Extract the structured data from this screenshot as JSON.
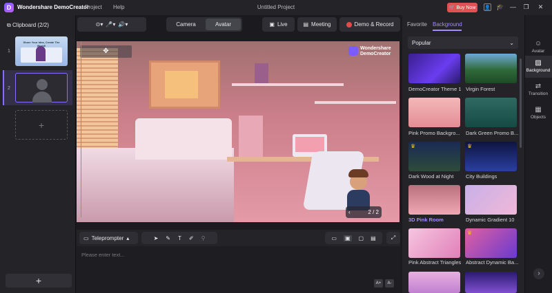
{
  "app": {
    "name": "Wondershare DemoCreator",
    "logo_letter": "D",
    "menu": [
      "Project",
      "Help"
    ],
    "doc_title": "Untitled Project",
    "buy_label": "Buy Now"
  },
  "left": {
    "clipboard_label": "Clipboard (2/2)",
    "clip_numbers": [
      "1",
      "2"
    ],
    "clip1_caption": "Share Your Idea, Create The World!",
    "add_symbol": "+"
  },
  "toolbar": {
    "camera": "Camera",
    "avatar": "Avatar",
    "live": "Live",
    "meeting": "Meeting",
    "demo_record": "Demo & Record"
  },
  "canvas": {
    "watermark_line1": "Wondershare",
    "watermark_line2": "DemoCreator",
    "pager": "2 / 2"
  },
  "teleprompter": {
    "label": "Teleprompter",
    "placeholder": "Please enter text...",
    "font_up": "A+",
    "font_down": "A-"
  },
  "right": {
    "tab_favorite": "Favorite",
    "tab_background": "Background",
    "dropdown_value": "Popular",
    "backgrounds": [
      {
        "label": "DemoCreator Theme 1",
        "selected": false
      },
      {
        "label": "Virgin Forest",
        "selected": false
      },
      {
        "label": "Pink Promo Backgro...",
        "selected": false
      },
      {
        "label": "Dark Green Promo B...",
        "selected": false
      },
      {
        "label": "Dark Wood at Night",
        "selected": false
      },
      {
        "label": "City Buildings",
        "selected": false
      },
      {
        "label": "3D Pink Room",
        "selected": true
      },
      {
        "label": "Dynamic Gradient 10",
        "selected": false
      },
      {
        "label": "Pink Abstract Triangles",
        "selected": false
      },
      {
        "label": "Abstract Dynamic Ba...",
        "selected": false
      }
    ]
  },
  "rail": {
    "avatar": "Avatar",
    "background": "Background",
    "transition": "Transition",
    "objects": "Objects"
  },
  "colors": {
    "accent": "#a58cff",
    "buy": "#e25151",
    "record": "#e24b4b"
  }
}
